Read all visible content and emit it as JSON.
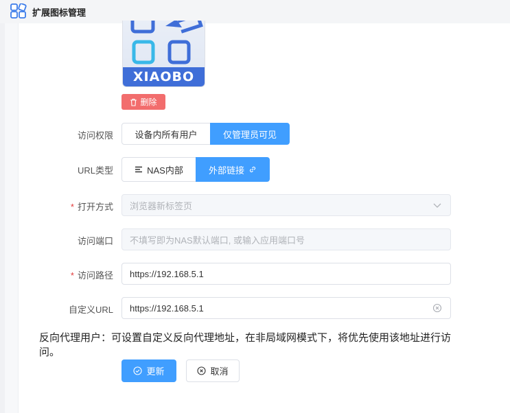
{
  "window": {
    "title": "扩展图标管理"
  },
  "logo": {
    "text": "XIAOBO"
  },
  "delete_button": {
    "label": "删除",
    "color": "#f26d6d"
  },
  "access": {
    "label": "访问权限",
    "options": [
      "设备内所有用户",
      "仅管理员可见"
    ],
    "selected": "仅管理员可见"
  },
  "url_type": {
    "label": "URL类型",
    "options": [
      "NAS内部",
      "外部链接"
    ],
    "selected": "外部链接"
  },
  "open_mode": {
    "required": "*",
    "label": "打开方式",
    "value": "浏览器新标签页"
  },
  "port": {
    "label": "访问端口",
    "placeholder": "不填写即为NAS默认端口, 或输入应用端口号"
  },
  "path": {
    "required": "*",
    "label": "访问路径",
    "value": "https://192.168.5.1"
  },
  "custom_url": {
    "label": "自定义URL",
    "value": "https://192.168.5.1"
  },
  "note": "反向代理用户：可设置自定义反向代理地址，在非局域网模式下，将优先使用该地址进行访问。",
  "actions": {
    "update": "更新",
    "cancel": "取消"
  },
  "colors": {
    "primary": "#409eff",
    "danger": "#f26d6d",
    "required": "#e23b3b"
  }
}
